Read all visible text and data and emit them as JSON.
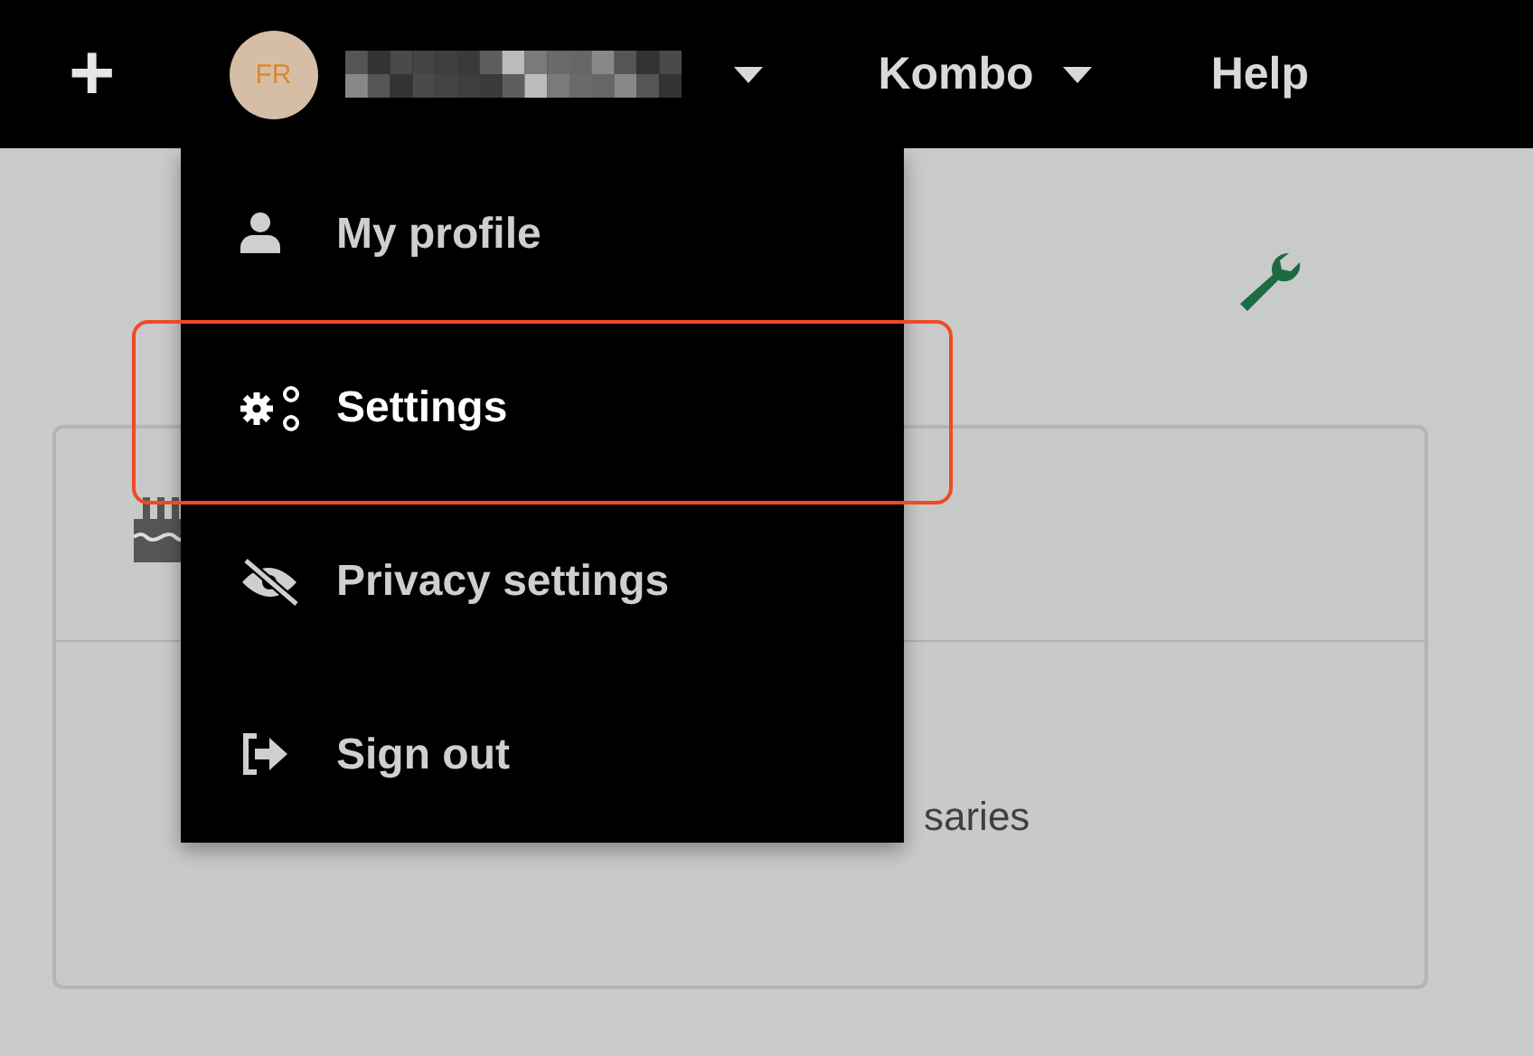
{
  "top_bar": {
    "add_label": "+",
    "avatar_initials": "FR",
    "user_name_redacted": true,
    "workspace": "Kombo",
    "help": "Help"
  },
  "user_menu": {
    "expanded": true,
    "items": [
      {
        "kind": "person",
        "label": "My profile",
        "highlighted": false
      },
      {
        "kind": "gears",
        "label": "Settings",
        "highlighted": true
      },
      {
        "kind": "eye-slash",
        "label": "Privacy settings",
        "highlighted": false
      },
      {
        "kind": "sign-out",
        "label": "Sign out",
        "highlighted": false
      }
    ]
  },
  "card": {
    "footer_text": "saries"
  }
}
